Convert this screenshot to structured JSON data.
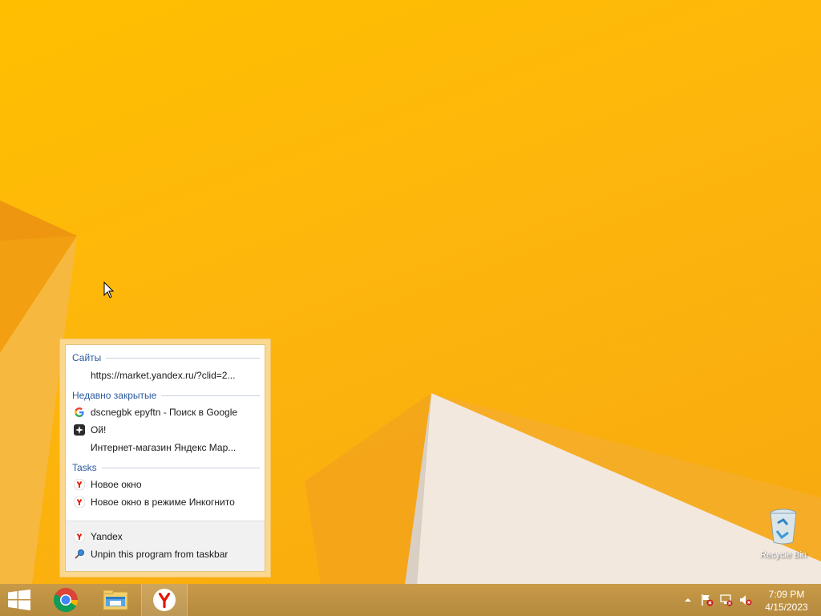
{
  "desktop": {
    "icons": [
      {
        "label": "Recycle Bin",
        "icon": "recycle-bin-icon"
      }
    ]
  },
  "jumplist": {
    "sections": {
      "sites": "Сайты",
      "recent": "Недавно закрытые",
      "tasks": "Tasks"
    },
    "sites_items": [
      {
        "label": "https://market.yandex.ru/?clid=2...",
        "icon": "none"
      }
    ],
    "recent_items": [
      {
        "label": "dscnegbk epyftn - Поиск в Google",
        "icon": "google-icon"
      },
      {
        "label": "Ой!",
        "icon": "sparkle-icon"
      },
      {
        "label": "Интернет-магазин Яндекс Мар...",
        "icon": "none"
      }
    ],
    "tasks_items": [
      {
        "label": "Новое окно",
        "icon": "yandex-icon"
      },
      {
        "label": "Новое окно в режиме Инкогнито",
        "icon": "yandex-icon"
      }
    ],
    "footer_items": [
      {
        "label": "Yandex",
        "icon": "yandex-icon"
      },
      {
        "label": "Unpin this program from taskbar",
        "icon": "pin-icon"
      }
    ]
  },
  "taskbar": {
    "apps": [
      {
        "name": "Start",
        "icon": "windows-logo-icon"
      },
      {
        "name": "Google Chrome",
        "icon": "chrome-icon"
      },
      {
        "name": "File Explorer",
        "icon": "folder-icon"
      },
      {
        "name": "Yandex Browser",
        "icon": "yandex-icon",
        "active": true
      }
    ],
    "tray": {
      "icons": [
        "show-hidden-icons-chevron",
        "action-center-flag-icon",
        "network-icon",
        "volume-muted-icon"
      ],
      "time": "7:09 PM",
      "date": "4/15/2023"
    }
  },
  "colors": {
    "wallpaper": "#ffbf00",
    "taskbar": "#c89a48",
    "jumplist_frame": "#fbd88f",
    "section_header": "#2a5a9c",
    "yandex_red": "#e61400"
  }
}
